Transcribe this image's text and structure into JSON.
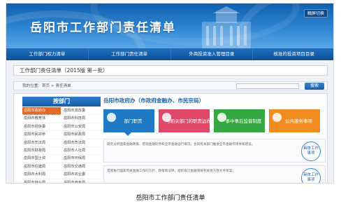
{
  "site": {
    "title": "岳阳市工作部门责任清单",
    "mobile_switch": "触屏切换"
  },
  "nav": {
    "items": [
      "工作部门权力清单",
      "工作部门责任清单",
      "外商投资准入管理目录",
      "核准的投资项目目录"
    ]
  },
  "list_title": "工作部门责任清单（2015版  第一批）",
  "breadcrumb": "我的位置：首页 > 责任清单",
  "search": {
    "placeholder": "",
    "button": "搜索"
  },
  "sidebar": {
    "heading": "按部门",
    "departments": [
      "岳阳市政府办",
      "岳阳市发改委",
      "岳阳市教育体",
      "岳阳市科技局",
      "岳阳市经信委",
      "岳阳市公安局",
      "岳阳市民宗侨",
      "岳阳市民政局",
      "岳阳市司法局",
      "岳阳市司法局",
      "岳阳市财政局",
      "岳阳市人社局",
      "岳阳市国土资",
      "岳阳市环保局",
      "岳阳市住建局",
      "岳阳市交通局",
      "岳阳市水利局",
      "岳阳市农业委",
      "岳阳市林业局",
      "岳阳市商务局",
      "岳阳市卫计委",
      "岳阳市审计局"
    ],
    "active_index": 0
  },
  "content": {
    "department_name": "岳阳市政府办（市政府金融办、市民宗局）",
    "cards": [
      "部门职责",
      "与相关部门的职责边界",
      "事中事后监督制度",
      "公共服务事项"
    ],
    "duties": [
      {
        "text": "研究分析国家金融政策、宏观金融形势和全市金融运行情况，会同有关部门推进全市金融市场体系建设。",
        "badge": "具体工作事项"
      },
      {
        "text": "贯彻执行国家有关金融工作的方针、政策和法律，组织拟订金融领域有关地方性文件草案；",
        "badge": "具体工作事项"
      }
    ]
  },
  "caption": "岳阳市工作部门责任清单",
  "colors": {
    "banner": "#2f86d3",
    "nav": "#1f6fbf",
    "active_dept": "#e06a2a",
    "card_blue": "#1f79c4",
    "card_pink": "#e0486a",
    "card_green": "#35a743",
    "card_orange": "#f08c20"
  }
}
